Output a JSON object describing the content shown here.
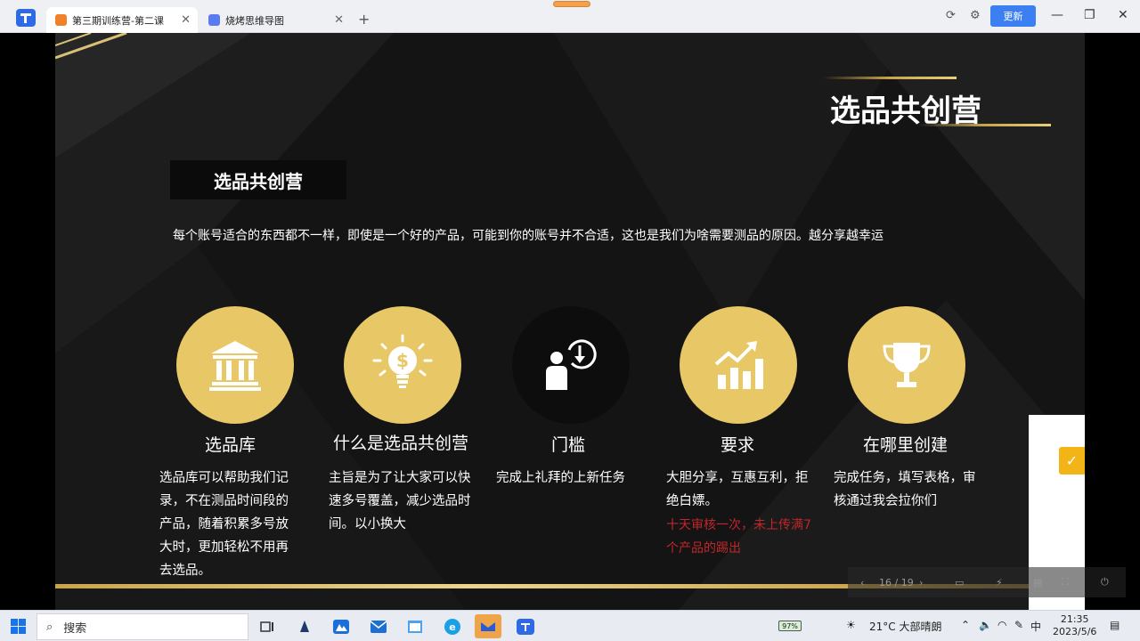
{
  "browser": {
    "tabs": [
      {
        "title": "第三期训练营-第二课",
        "active": true,
        "icon_color": "#f0812a"
      },
      {
        "title": "烧烤思维导图",
        "active": false,
        "icon_color": "#5b7cf0"
      }
    ],
    "update_label": "更新",
    "new_tab_icon": "plus-icon",
    "window_controls": [
      "minimize-icon",
      "maximize-icon",
      "close-icon"
    ]
  },
  "slide": {
    "brand_title": "选品共创营",
    "section_title": "选品共创营",
    "intro": "每个账号适合的东西都不一样，即使是一个好的产品，可能到你的账号并不合适，这也是我们为啥需要测品的原因。越分享越幸运",
    "columns": [
      {
        "icon": "bank-icon",
        "title": "选品库",
        "desc": "选品库可以帮助我们记录，不在测品时间段的产品，随着积累多号放大时，更加轻松不用再去选品。"
      },
      {
        "icon": "lightbulb-dollar-icon",
        "title": "什么是选品共创营",
        "desc": "主旨是为了让大家可以快速多号覆盖，减少选品时间。以小换大"
      },
      {
        "icon": "person-clock-icon",
        "title": "门槛",
        "desc": "完成上礼拜的上新任务"
      },
      {
        "icon": "growth-chart-icon",
        "title": "要求",
        "desc": "大胆分享，互惠互利，拒绝白嫖。",
        "warning": "十天审核一次，未上传满7个产品的踢出"
      },
      {
        "icon": "trophy-icon",
        "title": "在哪里创建",
        "desc": "完成任务，填写表格，审核通过我会拉你们"
      }
    ],
    "colors": {
      "gold": "#e7c766",
      "warning": "#c0262a"
    }
  },
  "player": {
    "page": "16 / 19"
  },
  "taskbar": {
    "search_placeholder": "搜索",
    "weather": "21°C 大部晴朗",
    "battery": "97%",
    "ime": "中",
    "time": "21:35",
    "date": "2023/5/6"
  }
}
